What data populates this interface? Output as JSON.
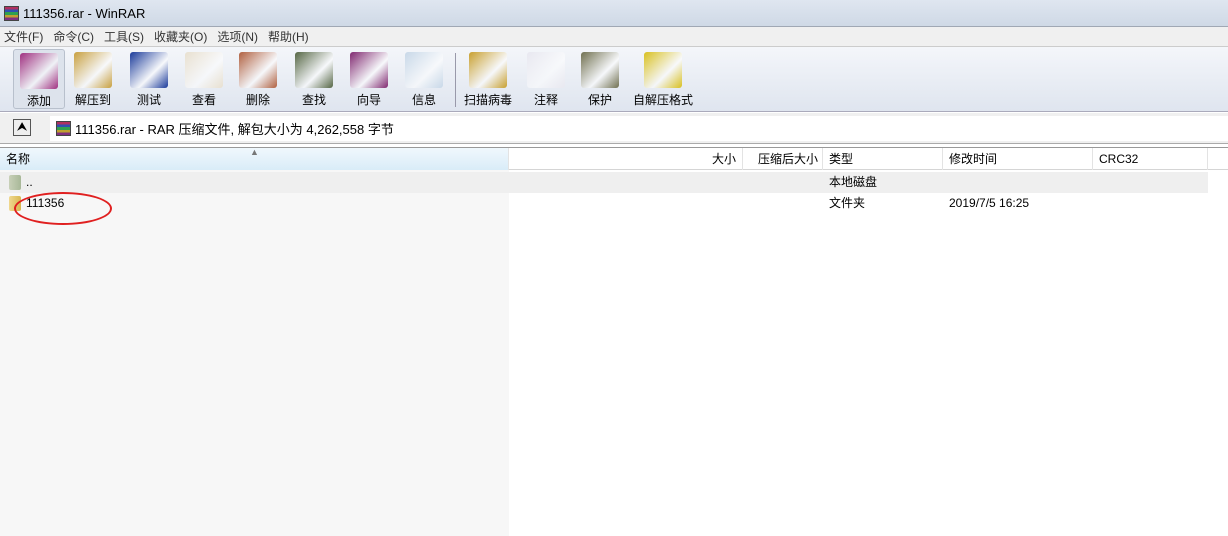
{
  "window": {
    "title": "111356.rar - WinRAR"
  },
  "menu": [
    "文件(F)",
    "命令(C)",
    "工具(S)",
    "收藏夹(O)",
    "选项(N)",
    "帮助(H)"
  ],
  "toolbar": [
    {
      "label": "添加",
      "icon": "add-archive-icon",
      "color": "#a03080"
    },
    {
      "label": "解压到",
      "icon": "extract-to-icon",
      "color": "#c8a040"
    },
    {
      "label": "测试",
      "icon": "test-icon",
      "color": "#1a3a9a"
    },
    {
      "label": "查看",
      "icon": "view-icon",
      "color": "#e8e0d0"
    },
    {
      "label": "删除",
      "icon": "delete-icon",
      "color": "#b06040"
    },
    {
      "label": "查找",
      "icon": "find-icon",
      "color": "#556644"
    },
    {
      "label": "向导",
      "icon": "wizard-icon",
      "color": "#802870"
    },
    {
      "label": "信息",
      "icon": "info-icon",
      "color": "#c8d8e8"
    },
    {
      "label": "扫描病毒",
      "icon": "virus-scan-icon",
      "color": "#c8a030"
    },
    {
      "label": "注释",
      "icon": "comment-icon",
      "color": "#e8e8f0"
    },
    {
      "label": "保护",
      "icon": "protect-icon",
      "color": "#707050"
    },
    {
      "label": "自解压格式",
      "icon": "sfx-icon",
      "color": "#d8c020"
    }
  ],
  "address": {
    "text": "111356.rar - RAR 压缩文件, 解包大小为 4,262,558 字节"
  },
  "columns": [
    "名称",
    "大小",
    "压缩后大小",
    "类型",
    "修改时间",
    "CRC32"
  ],
  "rows": [
    {
      "name": "..",
      "size": "",
      "packed": "",
      "type": "本地磁盘",
      "modified": "",
      "crc": ""
    },
    {
      "name": "111356",
      "size": "",
      "packed": "",
      "type": "文件夹",
      "modified": "2019/7/5 16:25",
      "crc": ""
    }
  ]
}
